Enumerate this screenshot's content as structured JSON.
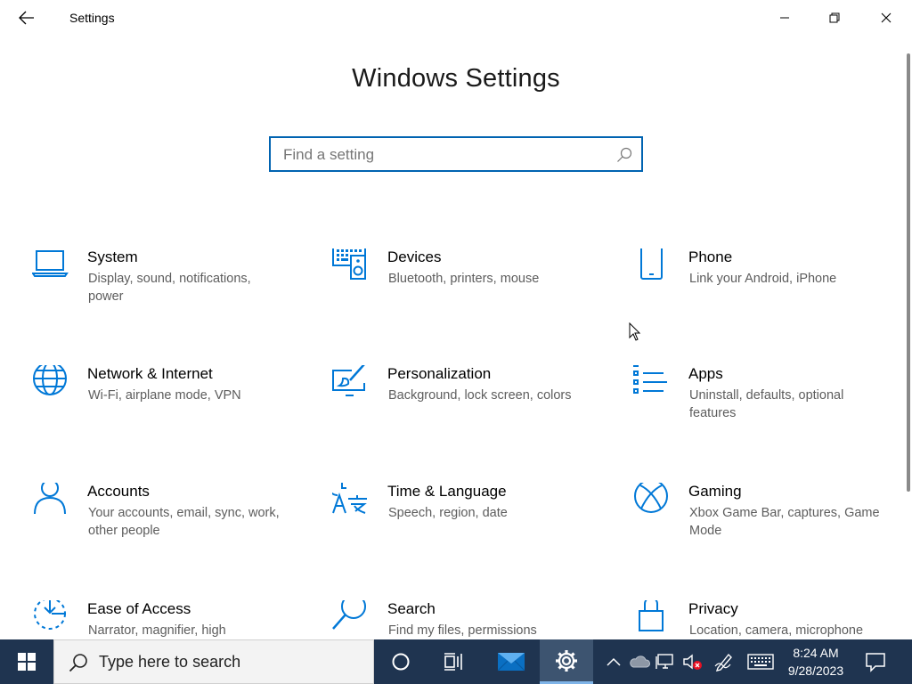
{
  "window": {
    "title": "Settings",
    "back_icon": "back-arrow-icon",
    "controls": [
      "minimize-icon",
      "maximize-icon",
      "close-icon"
    ]
  },
  "main": {
    "heading": "Windows Settings",
    "search": {
      "placeholder": "Find a setting",
      "value": ""
    }
  },
  "tiles": [
    {
      "name": "System",
      "desc": "Display, sound, notifications, power",
      "icon": "laptop-icon"
    },
    {
      "name": "Devices",
      "desc": "Bluetooth, printers, mouse",
      "icon": "keyboard-speaker-icon"
    },
    {
      "name": "Phone",
      "desc": "Link your Android, iPhone",
      "icon": "phone-icon"
    },
    {
      "name": "Network & Internet",
      "desc": "Wi-Fi, airplane mode, VPN",
      "icon": "globe-icon"
    },
    {
      "name": "Personalization",
      "desc": "Background, lock screen, colors",
      "icon": "paintbrush-icon"
    },
    {
      "name": "Apps",
      "desc": "Uninstall, defaults, optional features",
      "icon": "apps-list-icon"
    },
    {
      "name": "Accounts",
      "desc": "Your accounts, email, sync, work, other people",
      "icon": "person-icon"
    },
    {
      "name": "Time & Language",
      "desc": "Speech, region, date",
      "icon": "time-language-icon"
    },
    {
      "name": "Gaming",
      "desc": "Xbox Game Bar, captures, Game Mode",
      "icon": "xbox-icon"
    },
    {
      "name": "Ease of Access",
      "desc": "Narrator, magnifier, high",
      "icon": "ease-of-access-icon"
    },
    {
      "name": "Search",
      "desc": "Find my files, permissions",
      "icon": "magnifier-icon"
    },
    {
      "name": "Privacy",
      "desc": "Location, camera, microphone",
      "icon": "lock-icon"
    }
  ],
  "taskbar": {
    "search_text": "Type here to search",
    "time": "8:24 AM",
    "date": "9/28/2023",
    "icons": [
      "windows-start-icon",
      "cortana-icon",
      "task-view-icon",
      "mail-icon",
      "settings-gear-icon"
    ],
    "tray": [
      "chevron-up-icon",
      "onedrive-icon",
      "network-icon",
      "volume-muted-icon",
      "pen-icon",
      "touch-keyboard-icon",
      "notification-icon"
    ]
  },
  "colors": {
    "accent": "#0063b1",
    "icon_blue": "#0078d7",
    "taskbar": "#1f3450",
    "muted_badge": "#e81123"
  }
}
